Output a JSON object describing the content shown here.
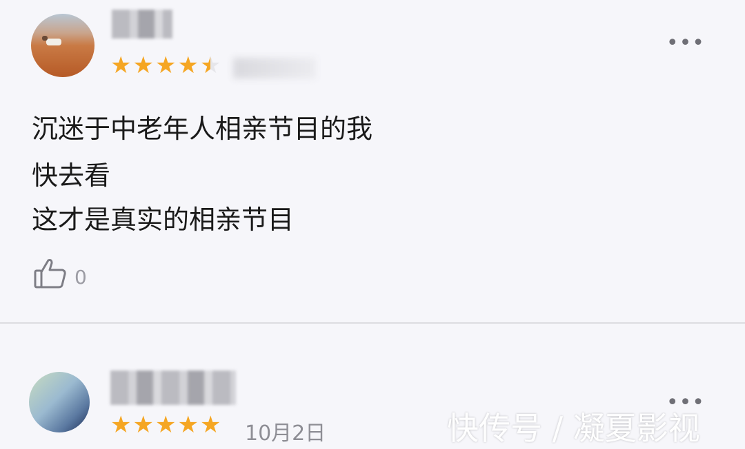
{
  "review1": {
    "comment_lines": [
      "沉迷于中老年人相亲节目的我",
      "快去看",
      "这才是真实的相亲节目"
    ],
    "rating": 4.5,
    "more_label": "•••",
    "like_count": "0"
  },
  "review2": {
    "rating": 5,
    "date": "10月2日",
    "more_label": "•••"
  },
  "watermark": "快传号 / 凝夏影视",
  "colors": {
    "star": "#f5a623",
    "background": "#f6f6fa",
    "text": "#1a1a1a"
  },
  "icons": [
    "thumbs-up-icon",
    "more-icon",
    "star-icon"
  ]
}
